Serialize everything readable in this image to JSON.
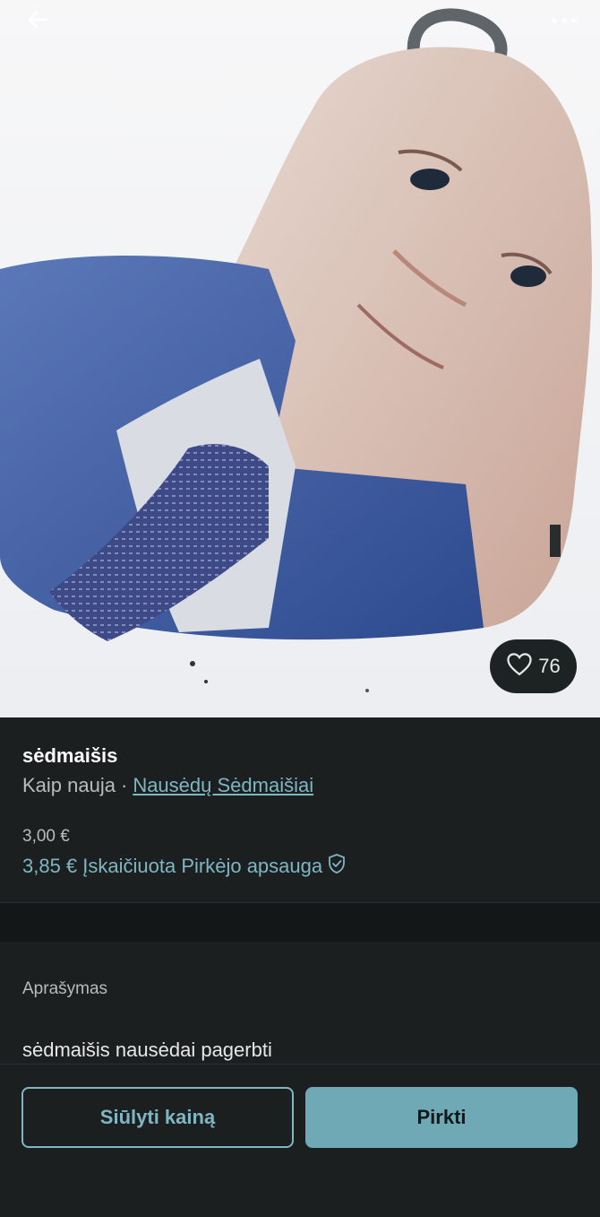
{
  "header": {
    "back_icon": "arrow-left-icon",
    "more_icon": "more-horizontal-icon"
  },
  "photo": {
    "like_icon": "heart-outline-icon",
    "like_count": "76"
  },
  "listing": {
    "title": "sėdmaišis",
    "condition": "Kaip nauja",
    "separator": "·",
    "brand": "Nausėdų Sėdmaišiai",
    "price": "3,00 €",
    "price_with_protection": "3,85 € Įskaičiuota Pirkėjo apsauga",
    "protection_icon": "shield-check-icon"
  },
  "description": {
    "label": "Aprašymas",
    "text": "sėdmaišis nausėdai pagerbti"
  },
  "actions": {
    "offer_label": "Siūlyti kainą",
    "buy_label": "Pirkti"
  },
  "colors": {
    "accent": "#7fb6c2",
    "buy_button": "#6fa9b5",
    "background": "#1b1f20"
  }
}
